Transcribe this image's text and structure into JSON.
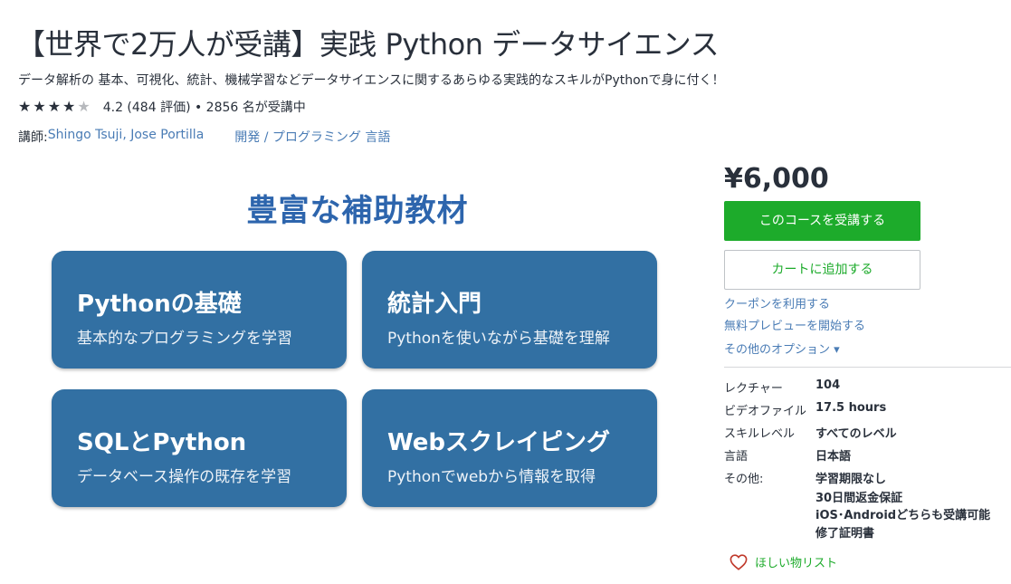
{
  "course": {
    "title": "【世界で2万人が受講】実践 Python データサイエンス",
    "subtitle": "データ解析の 基本、可視化、統計、機械学習などデータサイエンスに関するあらゆる実践的なスキルがPythonで身に付く！",
    "rating": 4.2,
    "rating_text": "4.2 (484 評価) • 2856 名が受講中",
    "instructor_label": "講師: ",
    "instructors": "Shingo Tsuji, Jose Portilla",
    "category": "開発",
    "category_sep": " / ",
    "subcategory": "プログラミング 言語"
  },
  "promo": {
    "heading": "豊富な補助教材",
    "cards": [
      {
        "title": "Pythonの基礎",
        "sub": "基本的なプログラミングを学習"
      },
      {
        "title": "統計入門",
        "sub": "Pythonを使いながら基礎を理解"
      },
      {
        "title": "SQLとPython",
        "sub": "データベース操作の既存を学習"
      },
      {
        "title": "Webスクレイピング",
        "sub": "Pythonでwebから情報を取得"
      }
    ]
  },
  "purchase": {
    "price": "¥6,000",
    "enroll_label": "このコースを受講する",
    "cart_label": "カートに追加する",
    "coupon_link": "クーポンを利用する",
    "preview_link": "無料プレビューを開始する",
    "options_link": "その他のオプション ▾"
  },
  "details": [
    {
      "key": "レクチャー",
      "value": "104"
    },
    {
      "key": "ビデオファイル",
      "value": "17.5 hours"
    },
    {
      "key": "スキルレベル",
      "value": "すべてのレベル"
    },
    {
      "key": "言語",
      "value": "日本語"
    },
    {
      "key": "その他:",
      "value": "学習期限なし"
    }
  ],
  "extras": [
    "30日間返金保証",
    "iOS･Androidどちらも受講可能",
    "修了証明書"
  ],
  "wishlist_label": "ほしい物リスト",
  "colors": {
    "accent_green": "#1dab2b",
    "link_blue": "#4a7cb5",
    "card_blue": "#3270a3",
    "heading_blue": "#2d65ad"
  }
}
